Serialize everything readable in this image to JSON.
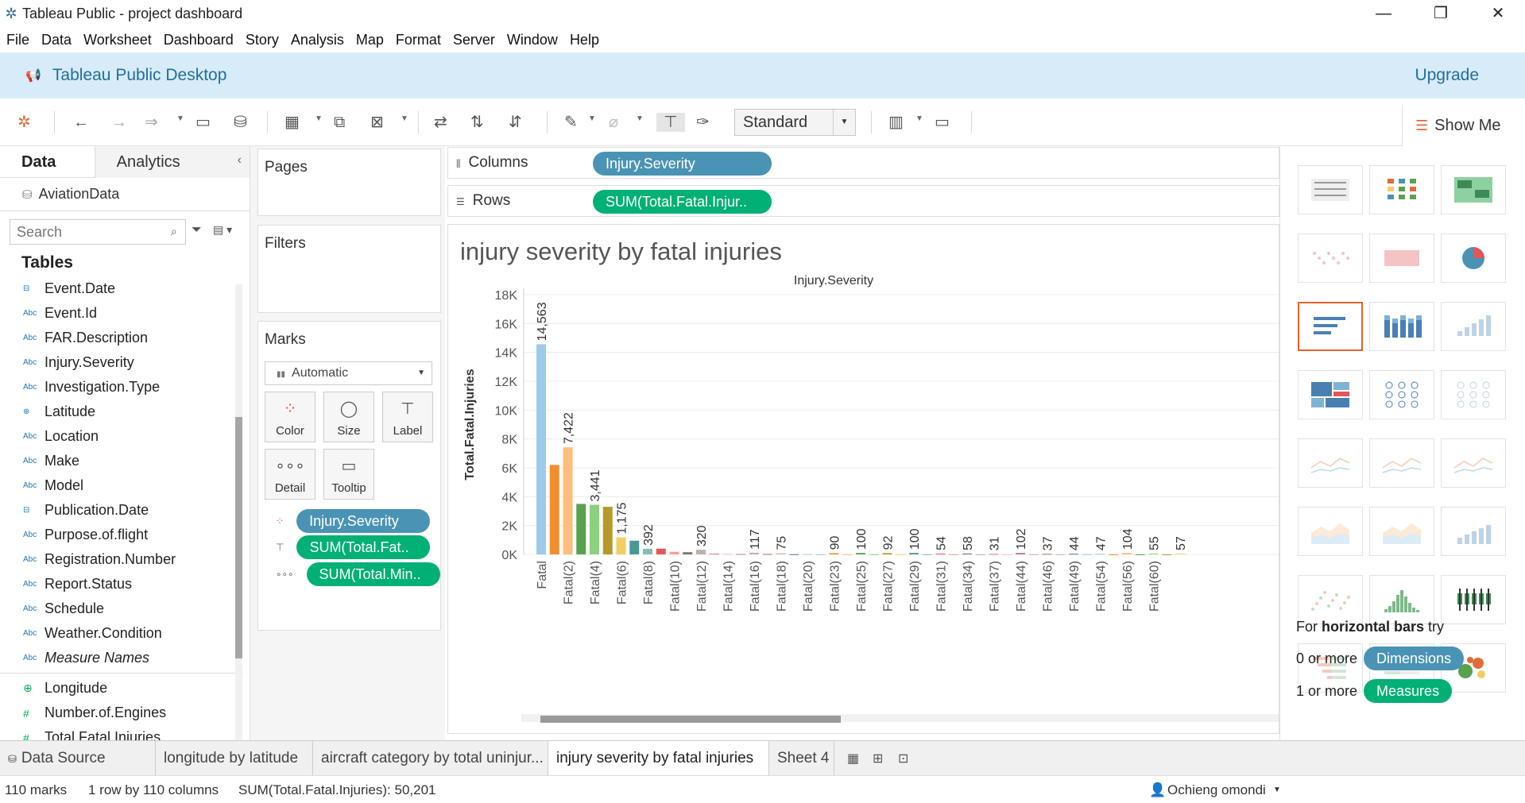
{
  "window": {
    "title": "Tableau Public - project dashboard",
    "minimize": "—",
    "restore": "❐",
    "close": "✕"
  },
  "menu": [
    "File",
    "Data",
    "Worksheet",
    "Dashboard",
    "Story",
    "Analysis",
    "Map",
    "Format",
    "Server",
    "Window",
    "Help"
  ],
  "banner": {
    "title": "Tableau Public Desktop",
    "upgrade": "Upgrade"
  },
  "toolbar": {
    "fit_select": "Standard",
    "show_me": "Show Me"
  },
  "data_pane": {
    "tab_data": "Data",
    "tab_analytics": "Analytics",
    "datasource": "AviationData",
    "search_placeholder": "Search",
    "tables_heading": "Tables",
    "dimensions": [
      {
        "type": "date",
        "name": "Event.Date"
      },
      {
        "type": "Abc",
        "name": "Event.Id"
      },
      {
        "type": "Abc",
        "name": "FAR.Description"
      },
      {
        "type": "Abc",
        "name": "Injury.Severity"
      },
      {
        "type": "Abc",
        "name": "Investigation.Type"
      },
      {
        "type": "geo",
        "name": "Latitude"
      },
      {
        "type": "Abc",
        "name": "Location"
      },
      {
        "type": "Abc",
        "name": "Make"
      },
      {
        "type": "Abc",
        "name": "Model"
      },
      {
        "type": "date",
        "name": "Publication.Date"
      },
      {
        "type": "Abc",
        "name": "Purpose.of.flight"
      },
      {
        "type": "Abc",
        "name": "Registration.Number"
      },
      {
        "type": "Abc",
        "name": "Report.Status"
      },
      {
        "type": "Abc",
        "name": "Schedule"
      },
      {
        "type": "Abc",
        "name": "Weather.Condition"
      },
      {
        "type": "Abc",
        "name": "Measure Names",
        "italic": true
      }
    ],
    "measures": [
      {
        "type": "geo",
        "name": "Longitude"
      },
      {
        "type": "#",
        "name": "Number.of.Engines"
      },
      {
        "type": "#",
        "name": "Total.Fatal.Injuries"
      }
    ]
  },
  "cards": {
    "pages": "Pages",
    "filters": "Filters",
    "marks": "Marks",
    "mark_type": "Automatic",
    "buttons": {
      "color": "Color",
      "size": "Size",
      "label": "Label",
      "detail": "Detail",
      "tooltip": "Tooltip"
    },
    "mark_pills": [
      "Injury.Severity",
      "SUM(Total.Fat..",
      "SUM(Total.Min.."
    ]
  },
  "shelves": {
    "columns_label": "Columns",
    "columns_pill": "Injury.Severity",
    "rows_label": "Rows",
    "rows_pill": "SUM(Total.Fatal.Injur.."
  },
  "sheet": {
    "title": "injury severity by fatal injuries"
  },
  "chart_data": {
    "type": "bar",
    "title": "injury severity by fatal injuries",
    "column_header": "Injury.Severity",
    "ylabel": "Total.Fatal.Injuries",
    "ylim": [
      0,
      18000
    ],
    "yticks": [
      "0K",
      "2K",
      "4K",
      "6K",
      "8K",
      "10K",
      "12K",
      "14K",
      "16K",
      "18K"
    ],
    "categories": [
      "Fatal",
      "",
      "Fatal(2)",
      "",
      "Fatal(4)",
      "",
      "Fatal(6)",
      "",
      "Fatal(8)",
      "",
      "Fatal(10)",
      "",
      "Fatal(12)",
      "",
      "Fatal(14)",
      "",
      "Fatal(16)",
      "",
      "Fatal(18)",
      "",
      "Fatal(20)",
      "",
      "Fatal(23)",
      "",
      "Fatal(25)",
      "",
      "Fatal(27)",
      "",
      "Fatal(29)",
      "",
      "Fatal(31)",
      "",
      "Fatal(34)",
      "",
      "Fatal(37)",
      "",
      "Fatal(44)",
      "",
      "Fatal(46)",
      "",
      "Fatal(49)",
      "",
      "Fatal(54)",
      "",
      "Fatal(56)",
      "",
      "Fatal(60)"
    ],
    "values": [
      14563,
      6200,
      7422,
      3500,
      3441,
      3300,
      1175,
      950,
      392,
      400,
      180,
      150,
      320,
      50,
      40,
      25,
      117,
      30,
      75,
      10,
      20,
      10,
      90,
      8,
      100,
      10,
      92,
      10,
      100,
      8,
      54,
      6,
      58,
      6,
      31,
      5,
      102,
      6,
      37,
      5,
      44,
      6,
      47,
      5,
      104,
      4,
      55,
      4,
      57
    ],
    "labels": [
      "14,563",
      "",
      "7,422",
      "",
      "3,441",
      "",
      "1,175",
      "",
      "392",
      "",
      "",
      "",
      "320",
      "",
      "",
      "",
      "117",
      "",
      "75",
      "",
      "",
      "",
      "90",
      "",
      "100",
      "",
      "92",
      "",
      "100",
      "",
      "54",
      "",
      "58",
      "",
      "31",
      "",
      "102",
      "",
      "37",
      "",
      "44",
      "",
      "47",
      "",
      "104",
      "",
      "55",
      "",
      "57"
    ],
    "colors": [
      "#9ecae9",
      "#f28e2b",
      "#ffbe7d",
      "#59a14f",
      "#8cd17d",
      "#b6992d",
      "#f1ce63",
      "#499894",
      "#86bcb6",
      "#e15759",
      "#ff9d9a",
      "#79706e",
      "#bab0ac",
      "#d37295",
      "#fabfd2",
      "#b07aa1",
      "#d4a6c8",
      "#9d7660",
      "#d7b5a6",
      "#4e79a7",
      "#a0cbe8"
    ]
  },
  "show_me": {
    "hint_prefix": "For ",
    "hint_bold": "horizontal bars",
    "hint_suffix": " try",
    "dims_prefix": "0 or more",
    "dims_pill": "Dimensions",
    "meas_prefix": "1 or more",
    "meas_pill": "Measures"
  },
  "sheet_tabs": {
    "data_source": "Data Source",
    "tabs": [
      "longitude by latitude",
      "aircraft category by total uninjur...",
      "injury severity by fatal injuries",
      "Sheet 4"
    ]
  },
  "status": {
    "marks": "110 marks",
    "rows_cols": "1 row by 110 columns",
    "sum": "SUM(Total.Fatal.Injuries): 50,201",
    "user": "Ochieng omondi"
  }
}
